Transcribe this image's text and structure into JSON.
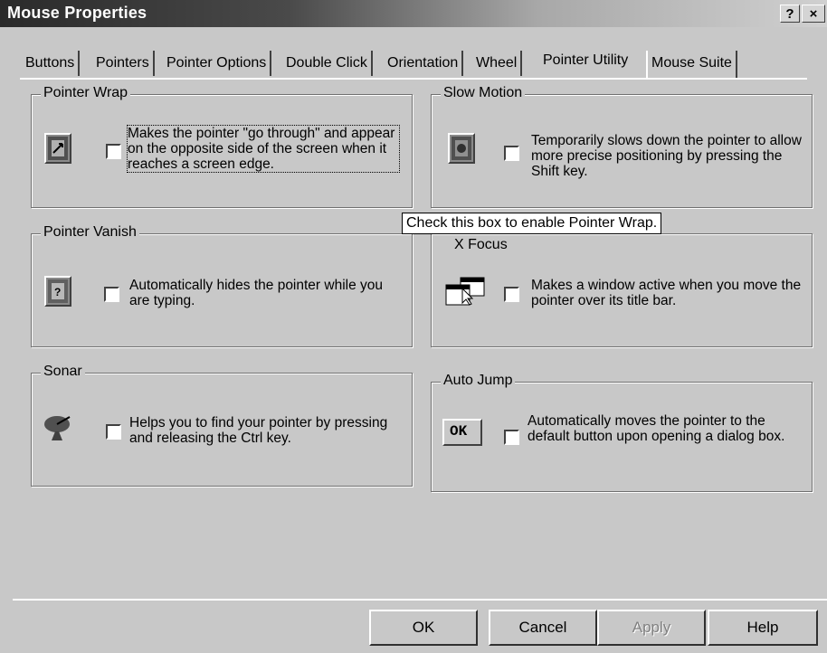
{
  "window": {
    "title": "Mouse Properties",
    "help_button": "?",
    "close_button": "×"
  },
  "tabs": [
    {
      "label": "Buttons"
    },
    {
      "label": "Pointers"
    },
    {
      "label": "Pointer Options"
    },
    {
      "label": "Double Click"
    },
    {
      "label": "Orientation"
    },
    {
      "label": "Wheel"
    },
    {
      "label": "Pointer Utility",
      "active": true
    },
    {
      "label": "Mouse Suite"
    }
  ],
  "groups": {
    "pointer_wrap": {
      "title": "Pointer Wrap",
      "description": "Makes the pointer \"go through\" and appear on the opposite side of the screen when it reaches a screen edge.",
      "checked": false
    },
    "slow_motion": {
      "title": "Slow Motion",
      "description": "Temporarily slows down the pointer to allow more precise positioning by pressing the Shift key.",
      "checked": false
    },
    "pointer_vanish": {
      "title": "Pointer Vanish",
      "description": "Automatically hides the pointer while you are typing.",
      "checked": false
    },
    "x_focus": {
      "title": "X Focus",
      "description": "Makes a window active when you move the pointer over its title bar.",
      "checked": false
    },
    "sonar": {
      "title": "Sonar",
      "description": "Helps you to find your pointer by pressing and releasing the Ctrl key.",
      "checked": false
    },
    "auto_jump": {
      "title": "Auto Jump",
      "description": "Automatically moves the pointer to the default button upon opening a dialog box.",
      "checked": false,
      "icon_label": "OK"
    }
  },
  "tooltip": "Check this box to enable Pointer Wrap.",
  "buttons": {
    "ok": "OK",
    "cancel": "Cancel",
    "apply": "Apply",
    "help": "Help"
  }
}
